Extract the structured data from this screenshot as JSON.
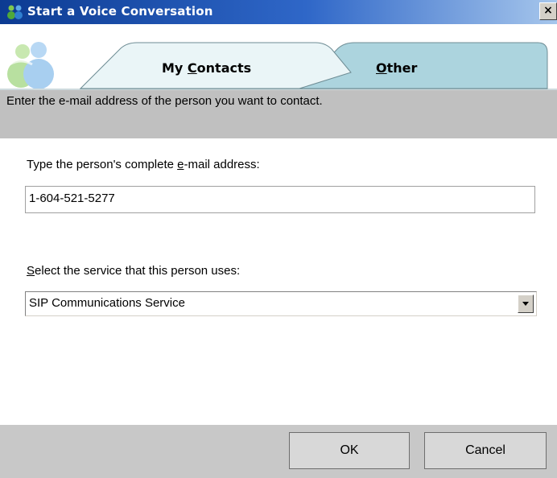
{
  "window": {
    "title": "Start a Voice Conversation",
    "close_label": "×"
  },
  "tabs": [
    {
      "label_pre": "My ",
      "label_accel": "C",
      "label_post": "ontacts",
      "selected": false
    },
    {
      "label_pre": "",
      "label_accel": "O",
      "label_post": "ther",
      "selected": true
    }
  ],
  "banner": {
    "text": "Enter the e-mail address of the person you want to contact."
  },
  "form": {
    "email_label_pre": "Type the person's complete ",
    "email_label_accel": "e",
    "email_label_post": "-mail address:",
    "email_value": "1-604-521-5277",
    "service_label_accel": "S",
    "service_label_post": "elect the service that this person uses:",
    "service_value": "SIP Communications Service"
  },
  "buttons": {
    "ok": "OK",
    "cancel": "Cancel"
  },
  "colors": {
    "titlebar_start": "#0c3b92",
    "titlebar_end": "#a6c6ec",
    "selected_tab": "#acd4de",
    "unselected_tab": "#eaf5f7",
    "banner": "#c0c0c0",
    "footer": "#c8c8c8"
  }
}
